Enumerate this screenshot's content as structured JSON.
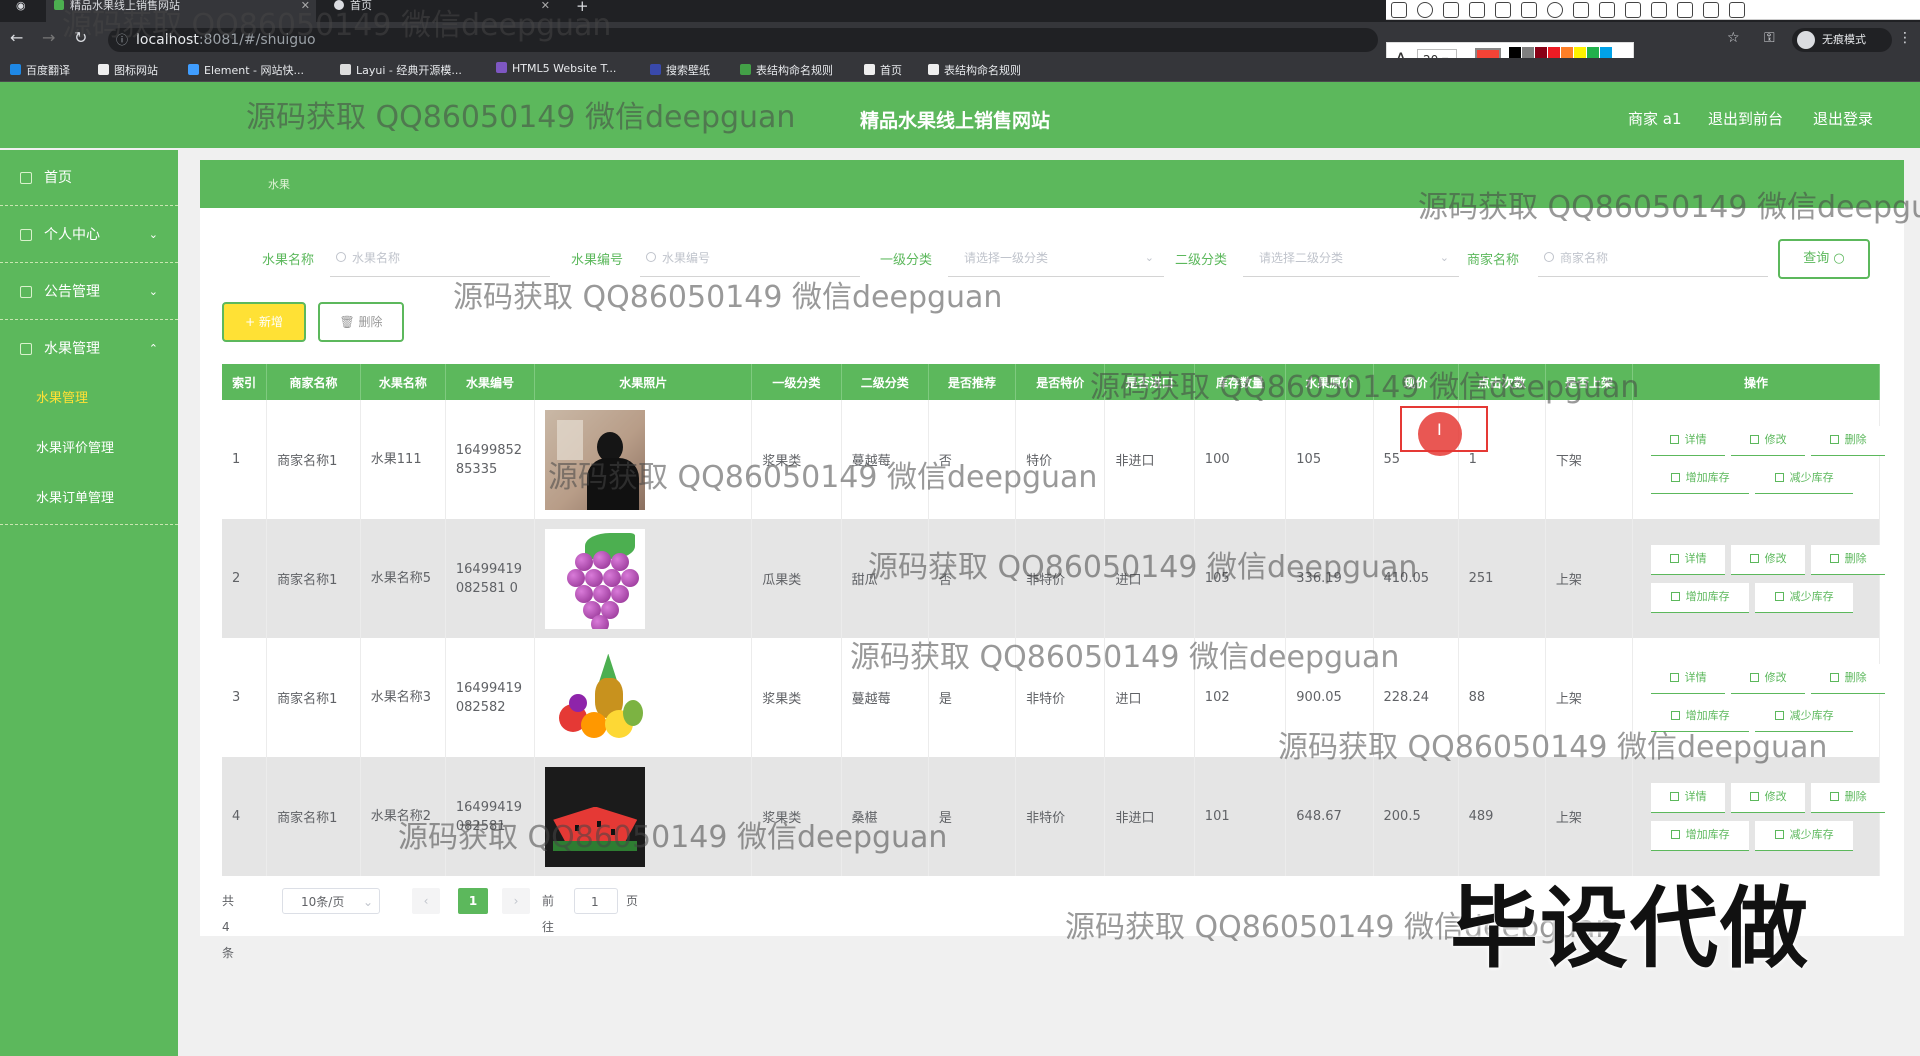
{
  "browser": {
    "tabs": [
      {
        "label": "精品水果线上销售网站",
        "active": true
      },
      {
        "label": "首页",
        "active": false
      }
    ],
    "url_host": "localhost",
    "url_path": ":8081/#/shuiguo",
    "bookmarks": [
      {
        "label": "百度翻译",
        "color": "#1e88e5"
      },
      {
        "label": "图标网站",
        "color": "#eeeeee"
      },
      {
        "label": "Element - 网站快...",
        "color": "#409eff"
      },
      {
        "label": "Layui - 经典开源模...",
        "color": "#dddddd"
      },
      {
        "label": "HTML5 Website T...",
        "color": "#7e57c2"
      },
      {
        "label": "搜索壁纸",
        "color": "#3949ab"
      },
      {
        "label": "表结构命名规则",
        "color": "#43a047"
      },
      {
        "label": "首页",
        "color": "#eeeeee"
      },
      {
        "label": "表结构命名规则",
        "color": "#eeeeee"
      }
    ],
    "profile": "无痕模式",
    "annotation_font_size": "20",
    "annotation_color": "#f44336",
    "palette": [
      "#000000",
      "#7f7f7f",
      "#880015",
      "#ed1c24",
      "#ff7f27",
      "#fff200",
      "#22b14c",
      "#00a2e8",
      "#3f48cc",
      "#a349a4",
      "#ffffff",
      "#c3c3c3",
      "#b97a57",
      "#ffaec9",
      "#ffc90e",
      "#efe4b0",
      "#b5e61d",
      "#99d9ea",
      "#7092be",
      "#c8bfe7"
    ]
  },
  "header": {
    "title": "精品水果线上销售网站",
    "user": "商家 a1",
    "to_front": "退出到前台",
    "logout": "退出登录",
    "brand_color": "#5cb85c"
  },
  "sidebar": {
    "items": [
      {
        "label": "首页",
        "icon": "home-icon"
      },
      {
        "label": "个人中心",
        "icon": "user-icon",
        "chevron": "⌄"
      },
      {
        "label": "公告管理",
        "icon": "notice-icon",
        "chevron": "⌄"
      },
      {
        "label": "水果管理",
        "icon": "fruit-icon",
        "chevron": "⌃"
      }
    ],
    "sub_items": [
      {
        "label": "水果管理",
        "active": true
      },
      {
        "label": "水果评价管理",
        "active": false
      },
      {
        "label": "水果订单管理",
        "active": false
      }
    ]
  },
  "breadcrumb": "水果",
  "filters": [
    {
      "label": "水果名称",
      "placeholder": "水果名称",
      "type": "input"
    },
    {
      "label": "水果编号",
      "placeholder": "水果编号",
      "type": "input"
    },
    {
      "label": "一级分类",
      "placeholder": "请选择一级分类",
      "type": "select"
    },
    {
      "label": "二级分类",
      "placeholder": "请选择二级分类",
      "type": "select"
    },
    {
      "label": "商家名称",
      "placeholder": "商家名称",
      "type": "input"
    }
  ],
  "query_label": "查询",
  "add_label": "+ 新增",
  "delete_label": "删除",
  "columns": [
    "索引",
    "商家名称",
    "水果名称",
    "水果编号",
    "水果照片",
    "一级分类",
    "二级分类",
    "是否推荐",
    "是否特价",
    "是否进口",
    "库存数量",
    "水果原价",
    "现价",
    "点击次数",
    "是否上架",
    "操作"
  ],
  "rows": [
    {
      "index": "1",
      "merchant": "商家名称1",
      "name": "水果111",
      "code": "1649985285335",
      "image": "portrait-photo",
      "cat1": "浆果类",
      "cat2": "蔓越莓",
      "recommend": "否",
      "special": "特价",
      "imported": "非进口",
      "stock": "100",
      "orig_price": "105",
      "price": "55",
      "clicks": "1",
      "on_shelf": "下架"
    },
    {
      "index": "2",
      "merchant": "商家名称1",
      "name": "水果名称5",
      "code": "16499419082581 0",
      "image": "grapes-photo",
      "cat1": "瓜果类",
      "cat2": "甜瓜",
      "recommend": "否",
      "special": "非特价",
      "imported": "进口",
      "stock": "105",
      "orig_price": "336.19",
      "price": "410.05",
      "clicks": "251",
      "on_shelf": "上架"
    },
    {
      "index": "3",
      "merchant": "商家名称1",
      "name": "水果名称3",
      "code": "16499419082582",
      "image": "mixed-fruit-photo",
      "cat1": "浆果类",
      "cat2": "蔓越莓",
      "recommend": "是",
      "special": "非特价",
      "imported": "进口",
      "stock": "102",
      "orig_price": "900.05",
      "price": "228.24",
      "clicks": "88",
      "on_shelf": "上架"
    },
    {
      "index": "4",
      "merchant": "商家名称1",
      "name": "水果名称2",
      "code": "16499419082581",
      "image": "watermelon-photo",
      "cat1": "浆果类",
      "cat2": "桑椹",
      "recommend": "是",
      "special": "非特价",
      "imported": "非进口",
      "stock": "101",
      "orig_price": "648.67",
      "price": "200.5",
      "clicks": "489",
      "on_shelf": "上架"
    }
  ],
  "row_actions": {
    "detail": "详情",
    "edit": "修改",
    "delete": "删除",
    "add_stock": "增加库存",
    "reduce_stock": "减少库存"
  },
  "pagination": {
    "total": "共 4 条",
    "page_size": "10条/页",
    "current": "1",
    "goto_label": "前往",
    "goto_value": "1",
    "page_suffix": "页"
  },
  "watermark": "源码获取 QQ86050149 微信deepguan",
  "watermark_big": "毕设代做"
}
